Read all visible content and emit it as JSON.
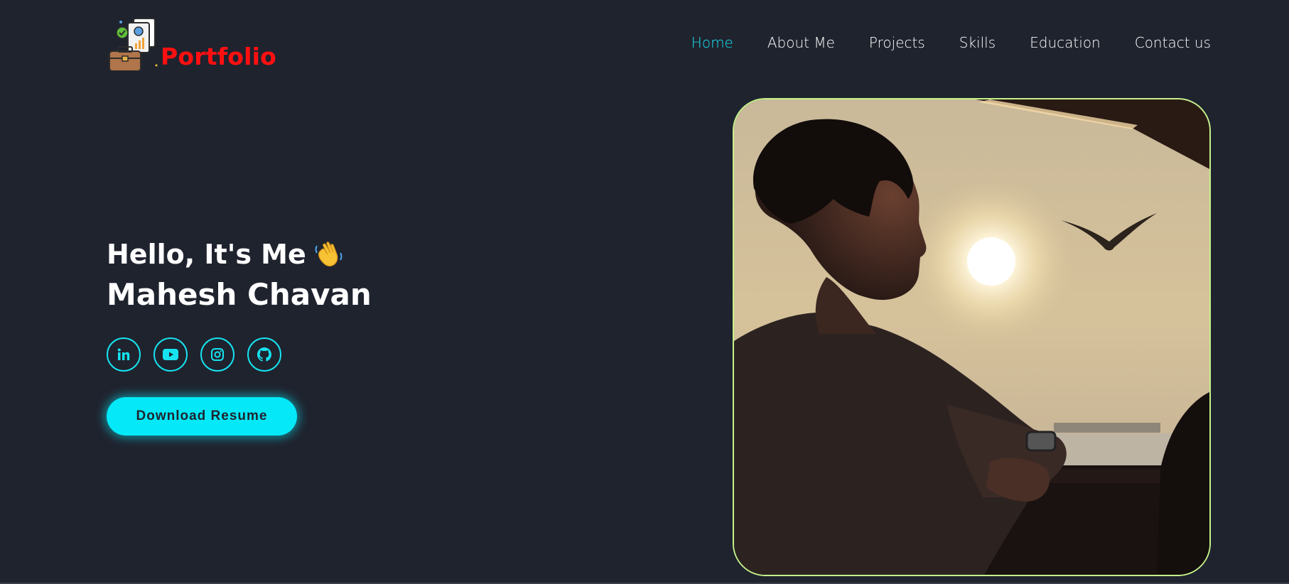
{
  "logo": {
    "text": "Portfolio",
    "icon": "briefcase-document-icon"
  },
  "nav": {
    "items": [
      {
        "label": "Home",
        "active": true
      },
      {
        "label": "About Me",
        "active": false
      },
      {
        "label": "Projects",
        "active": false
      },
      {
        "label": "Skills",
        "active": false
      },
      {
        "label": "Education",
        "active": false
      },
      {
        "label": "Contact us",
        "active": false
      }
    ]
  },
  "hero": {
    "greeting": "Hello, It's Me",
    "greeting_emoji": "waving-hand-icon",
    "name": "Mahesh Chavan",
    "socials": [
      "linkedin-icon",
      "youtube-icon",
      "instagram-icon",
      "github-icon"
    ],
    "button_label": "Download Resume"
  },
  "photo": {
    "subject": "profile-photo"
  },
  "colors": {
    "background": "#1f232e",
    "accent": "#05e8f7",
    "logo_text": "#ff1010",
    "photo_border": "#c5f28a"
  }
}
